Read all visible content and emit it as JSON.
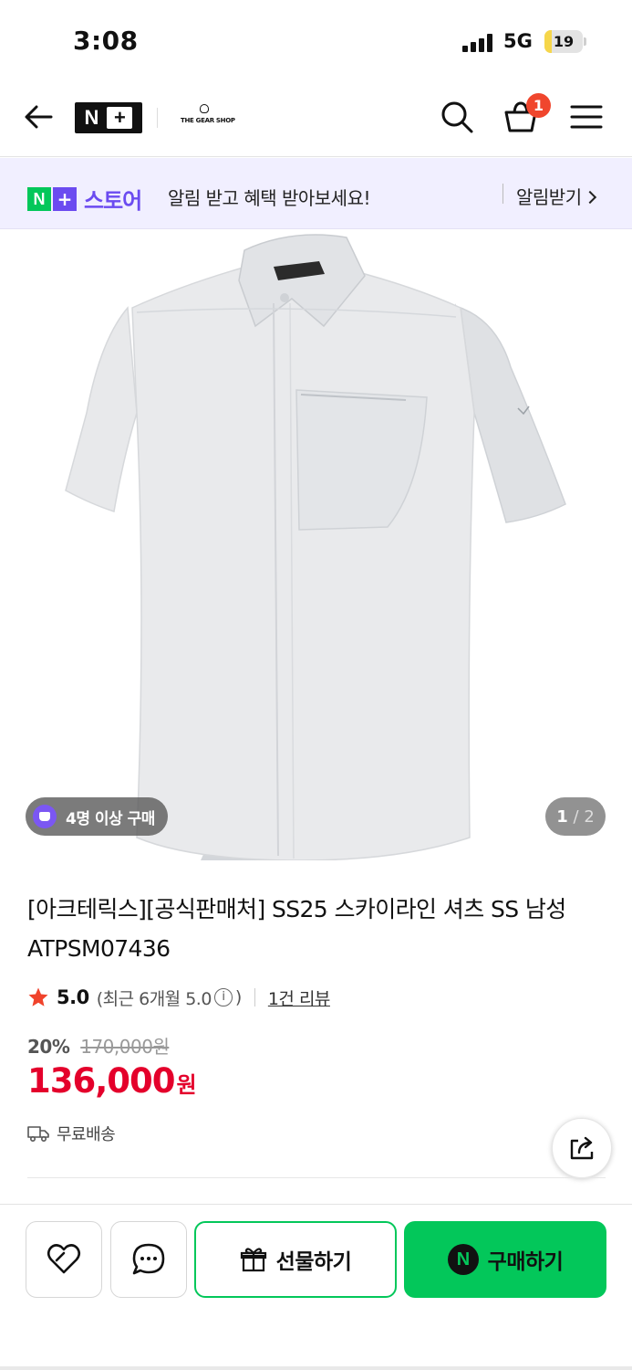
{
  "status_bar": {
    "time": "3:08",
    "network": "5G",
    "battery_level": "19",
    "battery_color": "#f6d64a"
  },
  "header": {
    "back_icon": "arrow-left-icon",
    "brand_logo_text": "N+",
    "shop_logo_text": "THE GEAR SHOP",
    "search_icon": "search-icon",
    "cart_icon": "cart-icon",
    "cart_count": "1",
    "menu_icon": "hamburger-menu-icon"
  },
  "notice": {
    "logo_n": "N",
    "logo_plus": "+",
    "logo_store": "스토어",
    "message": "알림 받고 혜택 받아보세요!",
    "button_label": "알림받기"
  },
  "gallery": {
    "buyers_badge": "4명 이상 구매",
    "current_page": "1",
    "page_separator": "/",
    "total_pages": "2"
  },
  "product": {
    "title": "[아크테릭스][공식판매처] SS25 스카이라인 셔츠 SS 남성 ATPSM07436",
    "rating_score": "5.0",
    "rating_recent_prefix": "(최근 6개월 5.0",
    "rating_recent_suffix": ")",
    "info_icon_glyph": "i",
    "review_count": "1건 리뷰",
    "discount_rate": "20%",
    "original_price": "170,000원",
    "sale_price": "136,000",
    "sale_unit": "원",
    "shipping": "무료배송",
    "accent_color": "#e4002b"
  },
  "bottom_bar": {
    "wishlist_icon": "heart-icon",
    "chat_icon": "chat-bubble-icon",
    "gift_label": "선물하기",
    "buy_badge": "N",
    "buy_label": "구매하기",
    "brand_green": "#03c75a"
  }
}
